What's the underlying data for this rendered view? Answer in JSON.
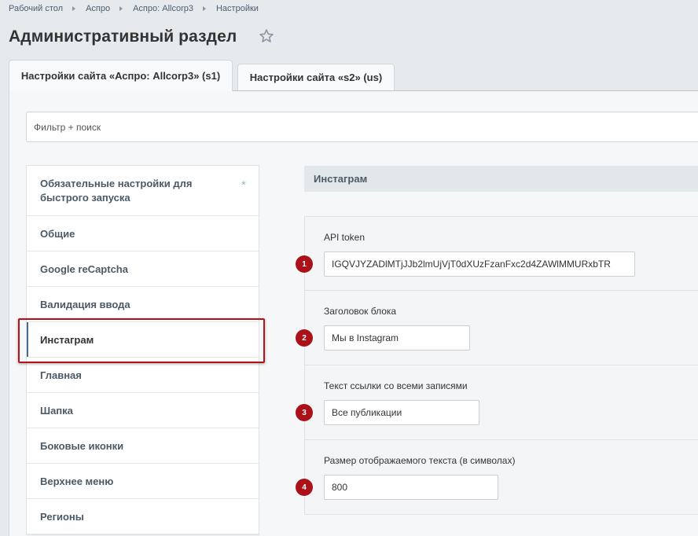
{
  "breadcrumb": [
    "Рабочий стол",
    "Аспро",
    "Аспро: Allcorp3",
    "Настройки"
  ],
  "page_title": "Административный раздел",
  "tabs": [
    {
      "label": "Настройки сайта «Аспро: Allcorp3» (s1)"
    },
    {
      "label": "Настройки сайта «s2» (us)"
    }
  ],
  "filter": {
    "placeholder": "Фильтр + поиск"
  },
  "sidebar": {
    "items": [
      {
        "label": "Обязательные настройки для быстрого запуска"
      },
      {
        "label": "Общие"
      },
      {
        "label": "Google reCaptcha"
      },
      {
        "label": "Валидация ввода"
      },
      {
        "label": "Инстаграм"
      },
      {
        "label": "Главная"
      },
      {
        "label": "Шапка"
      },
      {
        "label": "Боковые иконки"
      },
      {
        "label": "Верхнее меню"
      },
      {
        "label": "Регионы"
      }
    ],
    "required_mark": "*"
  },
  "section": {
    "title": "Инстаграм"
  },
  "fields": [
    {
      "badge": "1",
      "label": "API token",
      "value": "IGQVJYZADlMTjJJb2lmUjVjT0dXUzFzanFxc2d4ZAWlMMURxbTR"
    },
    {
      "badge": "2",
      "label": "Заголовок блока",
      "value": "Мы в Instagram"
    },
    {
      "badge": "3",
      "label": "Текст ссылки со всеми записями",
      "value": "Все публикации"
    },
    {
      "badge": "4",
      "label": "Размер отображаемого текста (в символах)",
      "value": "800"
    }
  ],
  "colors": {
    "badge": "#ab1119",
    "highlight": "#b5111b",
    "active_indicator": "#4a6b8a"
  }
}
